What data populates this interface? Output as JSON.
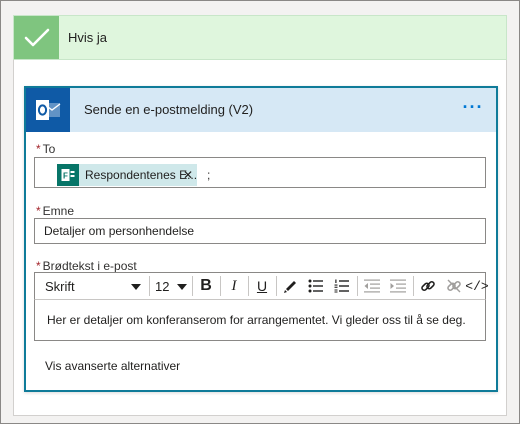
{
  "condition": {
    "title": "Hvis ja",
    "check_icon": "check-icon"
  },
  "action": {
    "title": "Sende en e-postmelding (V2)",
    "icon": "outlook-icon",
    "more_label": "···"
  },
  "fields": {
    "to": {
      "required": "*",
      "label": "To",
      "token_label": "Respondentenes E...",
      "token_remove": "✕",
      "token_icon": "forms-icon",
      "separator": ";"
    },
    "subject": {
      "required": "*",
      "label": "Emne",
      "value": "Detaljer om personhendelse"
    },
    "body": {
      "required": "*",
      "label": "Brødtekst i e-post",
      "value": "Her er detaljer om konferanserom for arrangementet. Vi gleder oss til å se deg."
    }
  },
  "toolbar": {
    "font_name": "Skrift",
    "font_size": "12",
    "bold": "B",
    "italic": "I",
    "underline": "U",
    "code": "</>"
  },
  "advanced_link": "Vis avanserte alternativer",
  "colors": {
    "success_band": "#dff6dd",
    "success_check": "#7fc57f",
    "action_border": "#0f7b99",
    "action_header": "#d6e8f5",
    "outlook_blue": "#0f5aa6",
    "forms_teal": "#077568",
    "token_bg": "#cfe8ea",
    "required_red": "#a4262c",
    "more_blue": "#0078d4"
  }
}
